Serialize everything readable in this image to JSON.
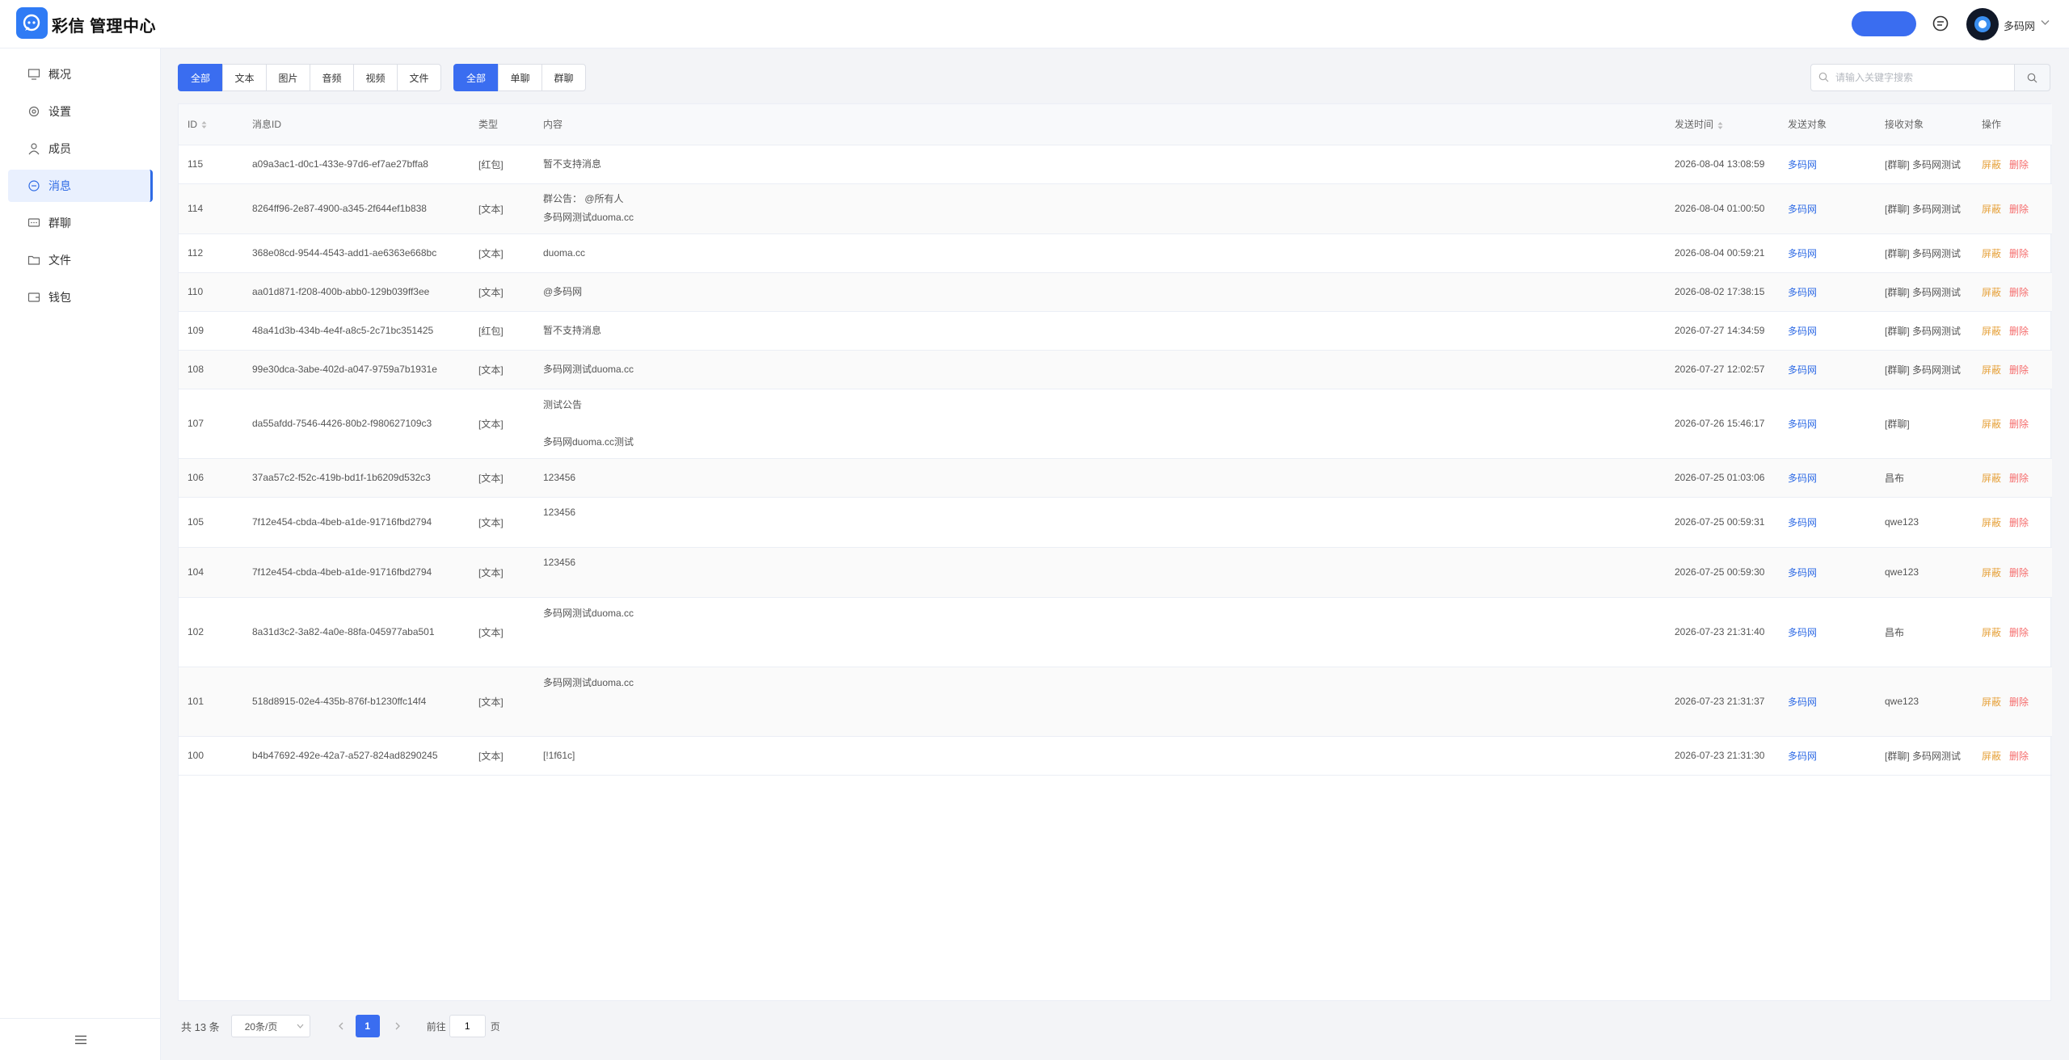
{
  "header": {
    "logo_text": "彩信 管理中心",
    "username": "多码网"
  },
  "sidebar": {
    "items": [
      {
        "label": "概况"
      },
      {
        "label": "设置"
      },
      {
        "label": "成员"
      },
      {
        "label": "消息"
      },
      {
        "label": "群聊"
      },
      {
        "label": "文件"
      },
      {
        "label": "钱包"
      }
    ]
  },
  "filters": {
    "type": [
      "全部",
      "文本",
      "图片",
      "音频",
      "视频",
      "文件"
    ],
    "chat": [
      "全部",
      "单聊",
      "群聊"
    ]
  },
  "search": {
    "placeholder": "请输入关键字搜索"
  },
  "table": {
    "headers": [
      "ID",
      "消息ID",
      "类型",
      "内容",
      "发送时间",
      "发送对象",
      "接收对象",
      "操作"
    ],
    "rows": [
      {
        "id": "115",
        "msg_id": "a09a3ac1-d0c1-433e-97d6-ef7ae27bffa8",
        "type": "[红包]",
        "content": [
          "暂不支持消息"
        ],
        "time": "2026-08-04 13:08:59",
        "sender": "多码网",
        "receiver": "[群聊] 多码网测试"
      },
      {
        "id": "114",
        "msg_id": "8264ff96-2e87-4900-a345-2f644ef1b838",
        "type": "[文本]",
        "content": [
          "群公告：  @所有人",
          "多码网测试duoma.cc"
        ],
        "time": "2026-08-04 01:00:50",
        "sender": "多码网",
        "receiver": "[群聊] 多码网测试"
      },
      {
        "id": "112",
        "msg_id": "368e08cd-9544-4543-add1-ae6363e668bc",
        "type": "[文本]",
        "content": [
          "duoma.cc"
        ],
        "time": "2026-08-04 00:59:21",
        "sender": "多码网",
        "receiver": "[群聊] 多码网测试"
      },
      {
        "id": "110",
        "msg_id": "aa01d871-f208-400b-abb0-129b039ff3ee",
        "type": "[文本]",
        "content": [
          "@多码网"
        ],
        "time": "2026-08-02 17:38:15",
        "sender": "多码网",
        "receiver": "[群聊] 多码网测试"
      },
      {
        "id": "109",
        "msg_id": "48a41d3b-434b-4e4f-a8c5-2c71bc351425",
        "type": "[红包]",
        "content": [
          "暂不支持消息"
        ],
        "time": "2026-07-27 14:34:59",
        "sender": "多码网",
        "receiver": "[群聊] 多码网测试"
      },
      {
        "id": "108",
        "msg_id": "99e30dca-3abe-402d-a047-9759a7b1931e",
        "type": "[文本]",
        "content": [
          "多码网测试duoma.cc"
        ],
        "time": "2026-07-27 12:02:57",
        "sender": "多码网",
        "receiver": "[群聊] 多码网测试"
      },
      {
        "id": "107",
        "msg_id": "da55afdd-7546-4426-80b2-f980627109c3",
        "type": "[文本]",
        "content": [
          "测试公告",
          "",
          "多码网duoma.cc测试"
        ],
        "time": "2026-07-26 15:46:17",
        "sender": "多码网",
        "receiver": "[群聊]"
      },
      {
        "id": "106",
        "msg_id": "37aa57c2-f52c-419b-bd1f-1b6209d532c3",
        "type": "[文本]",
        "content": [
          "123456"
        ],
        "time": "2026-07-25 01:03:06",
        "sender": "多码网",
        "receiver": "昌布"
      },
      {
        "id": "105",
        "msg_id": "7f12e454-cbda-4beb-a1de-91716fbd2794",
        "type": "[文本]",
        "content": [
          "123456",
          ""
        ],
        "time": "2026-07-25 00:59:31",
        "sender": "多码网",
        "receiver": "qwe123"
      },
      {
        "id": "104",
        "msg_id": "7f12e454-cbda-4beb-a1de-91716fbd2794",
        "type": "[文本]",
        "content": [
          "123456",
          ""
        ],
        "time": "2026-07-25 00:59:30",
        "sender": "多码网",
        "receiver": "qwe123"
      },
      {
        "id": "102",
        "msg_id": "8a31d3c2-3a82-4a0e-88fa-045977aba501",
        "type": "[文本]",
        "content": [
          "多码网测试duoma.cc",
          "",
          ""
        ],
        "time": "2026-07-23 21:31:40",
        "sender": "多码网",
        "receiver": "昌布"
      },
      {
        "id": "101",
        "msg_id": "518d8915-02e4-435b-876f-b1230ffc14f4",
        "type": "[文本]",
        "content": [
          "多码网测试duoma.cc",
          "",
          ""
        ],
        "time": "2026-07-23 21:31:37",
        "sender": "多码网",
        "receiver": "qwe123"
      },
      {
        "id": "100",
        "msg_id": "b4b47692-492e-42a7-a527-824ad8290245",
        "type": "[文本]",
        "content": [
          "[!1f61c]"
        ],
        "time": "2026-07-23 21:31:30",
        "sender": "多码网",
        "receiver": "[群聊] 多码网测试"
      }
    ],
    "actions": {
      "block": "屏蔽",
      "delete": "删除"
    }
  },
  "pagination": {
    "total": "共 13 条",
    "page_size": "20条/页",
    "current": "1",
    "goto_label": "前往",
    "goto_value": "1",
    "goto_unit": "页"
  },
  "colors": {
    "accent": "#3a6df0",
    "block": "#e6a23c",
    "delete": "#f56c6c"
  }
}
